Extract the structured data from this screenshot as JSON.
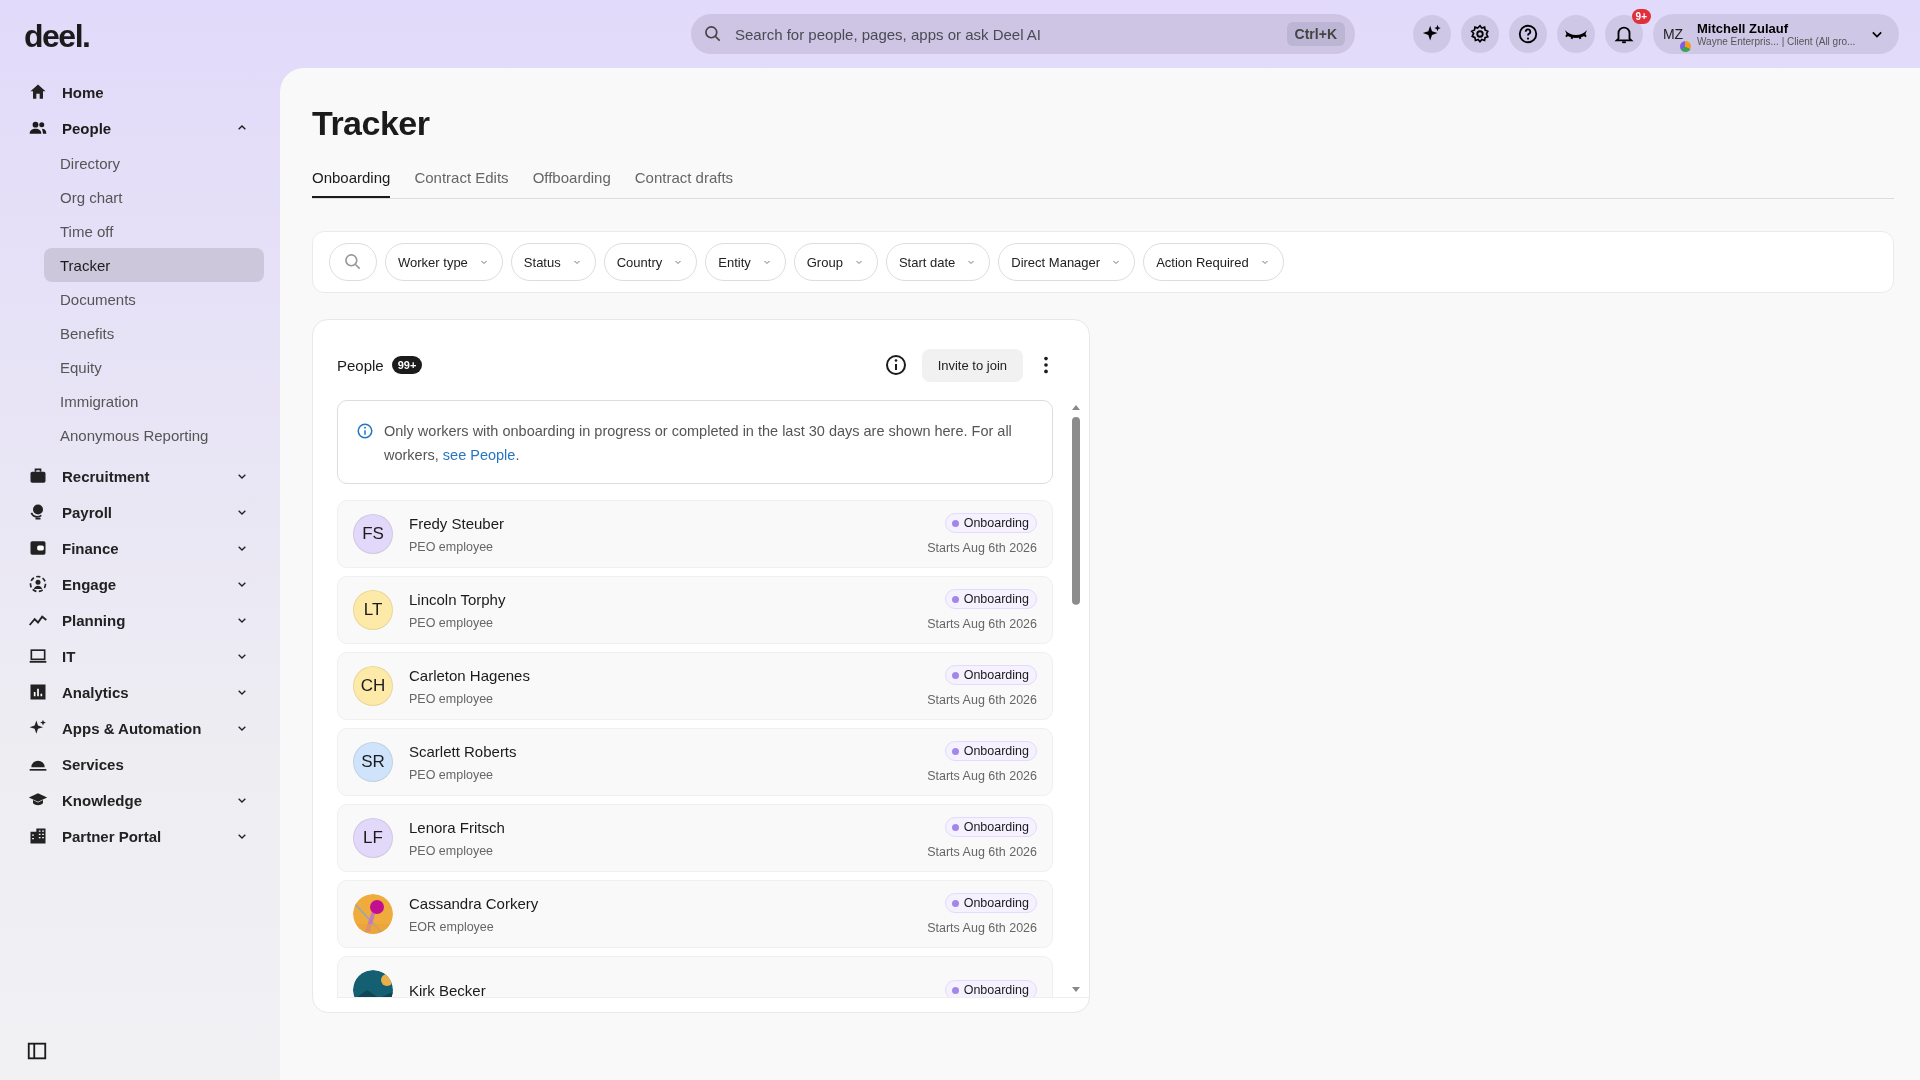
{
  "logo": "deel.",
  "search": {
    "placeholder": "Search for people, pages, apps or ask Deel AI",
    "shortcut": "Ctrl+K"
  },
  "notifications": {
    "badge": "9+"
  },
  "user": {
    "initials": "MZ",
    "name": "Mitchell Zulauf",
    "subtitle": "Wayne Enterpris... | Client (All gro..."
  },
  "sidebar": {
    "items": [
      {
        "label": "Home"
      },
      {
        "label": "People",
        "expanded": true,
        "children": [
          {
            "label": "Directory",
            "selected": false
          },
          {
            "label": "Org chart",
            "selected": false
          },
          {
            "label": "Time off",
            "selected": false
          },
          {
            "label": "Tracker",
            "selected": true
          },
          {
            "label": "Documents",
            "selected": false
          },
          {
            "label": "Benefits",
            "selected": false
          },
          {
            "label": "Equity",
            "selected": false
          },
          {
            "label": "Immigration",
            "selected": false
          },
          {
            "label": "Anonymous Reporting",
            "selected": false
          }
        ]
      },
      {
        "label": "Recruitment",
        "expanded": false
      },
      {
        "label": "Payroll",
        "expanded": false
      },
      {
        "label": "Finance",
        "expanded": false
      },
      {
        "label": "Engage",
        "expanded": false
      },
      {
        "label": "Planning",
        "expanded": false
      },
      {
        "label": "IT",
        "expanded": false
      },
      {
        "label": "Analytics",
        "expanded": false
      },
      {
        "label": "Apps & Automation",
        "expanded": false
      },
      {
        "label": "Services"
      },
      {
        "label": "Knowledge",
        "expanded": false
      },
      {
        "label": "Partner Portal",
        "expanded": false
      }
    ]
  },
  "page": {
    "title": "Tracker"
  },
  "tabs": [
    {
      "label": "Onboarding",
      "selected": true
    },
    {
      "label": "Contract Edits",
      "selected": false
    },
    {
      "label": "Offboarding",
      "selected": false
    },
    {
      "label": "Contract drafts",
      "selected": false
    }
  ],
  "filters": [
    "Worker type",
    "Status",
    "Country",
    "Entity",
    "Group",
    "Start date",
    "Direct Manager",
    "Action Required"
  ],
  "people_card": {
    "title": "People",
    "count": "99+",
    "invite_button": "Invite to join",
    "notice": "Only workers with onboarding in progress or completed in the last 30 days are shown here. For all workers, ",
    "notice_link": "see People",
    "notice_end": ".",
    "rows": [
      {
        "initials": "FS",
        "kind": "initials",
        "color": "#e2d9fa",
        "name": "Fredy Steuber",
        "type": "PEO employee",
        "status": "Onboarding",
        "start": "Starts Aug 6th 2026"
      },
      {
        "initials": "LT",
        "kind": "initials",
        "color": "#fdeaa8",
        "name": "Lincoln Torphy",
        "type": "PEO employee",
        "status": "Onboarding",
        "start": "Starts Aug 6th 2026"
      },
      {
        "initials": "CH",
        "kind": "initials",
        "color": "#fdeaa8",
        "name": "Carleton Hagenes",
        "type": "PEO employee",
        "status": "Onboarding",
        "start": "Starts Aug 6th 2026"
      },
      {
        "initials": "SR",
        "kind": "initials",
        "color": "#cfe4fb",
        "name": "Scarlett Roberts",
        "type": "PEO employee",
        "status": "Onboarding",
        "start": "Starts Aug 6th 2026"
      },
      {
        "initials": "LF",
        "kind": "initials",
        "color": "#e2d9fa",
        "name": "Lenora Fritsch",
        "type": "PEO employee",
        "status": "Onboarding",
        "start": "Starts Aug 6th 2026"
      },
      {
        "kind": "picture",
        "name": "Cassandra Corkery",
        "type": "EOR employee",
        "status": "Onboarding",
        "start": "Starts Aug 6th 2026"
      },
      {
        "kind": "picture",
        "name": "Kirk Becker",
        "status": "Onboarding"
      }
    ]
  }
}
